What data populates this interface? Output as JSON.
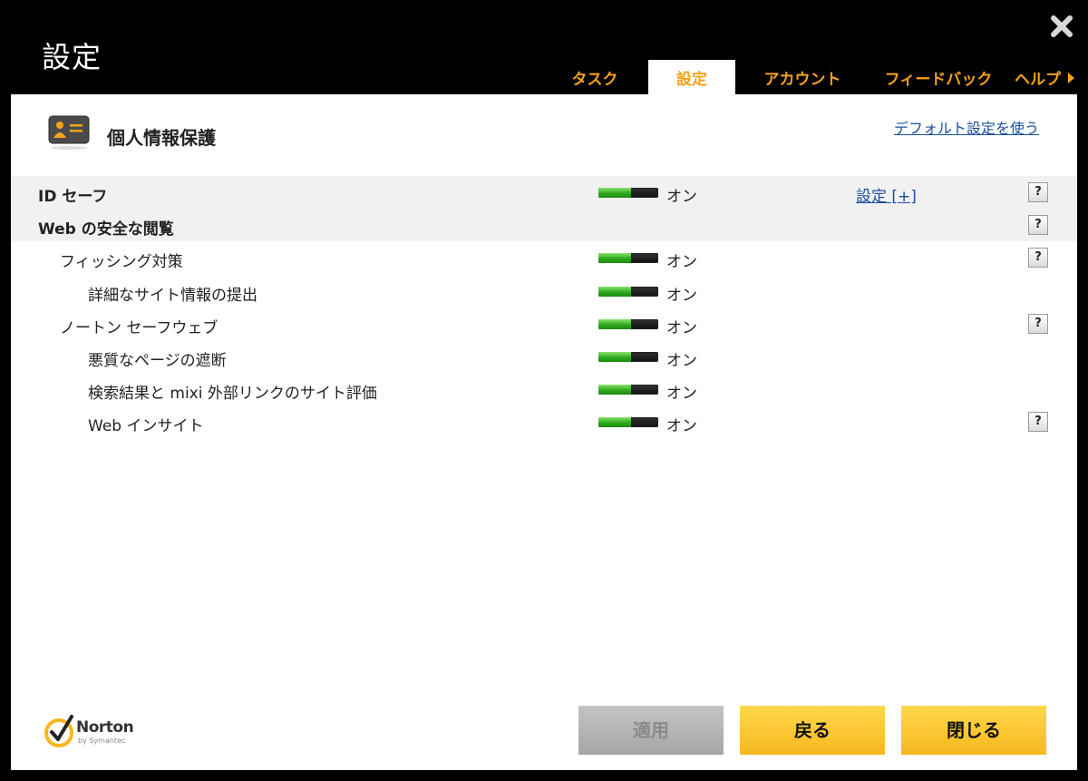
{
  "window": {
    "title": "設定"
  },
  "tabs": [
    {
      "label": "タスク",
      "active": false
    },
    {
      "label": "設定",
      "active": true
    },
    {
      "label": "アカウント",
      "active": false
    },
    {
      "label": "フィードバック",
      "active": false
    },
    {
      "label": "ヘルプ",
      "active": false
    }
  ],
  "header": {
    "icon": "id-card-icon",
    "title": "個人情報保護",
    "default_link": "デフォルト設定を使う"
  },
  "rows": [
    {
      "label": "ID セーフ",
      "state": "オン",
      "toggle_on": true,
      "settings_link": "設定 [+]",
      "help": "?"
    },
    {
      "label": "Web の安全な閲覧",
      "help": "?"
    },
    {
      "label": "フィッシング対策",
      "state": "オン",
      "toggle_on": true,
      "help": "?"
    },
    {
      "label": "詳細なサイト情報の提出",
      "state": "オン",
      "toggle_on": true
    },
    {
      "label": "ノートン セーフウェブ",
      "state": "オン",
      "toggle_on": true,
      "help": "?"
    },
    {
      "label": "悪質なページの遮断",
      "state": "オン",
      "toggle_on": true
    },
    {
      "label": "検索結果と mixi 外部リンクのサイト評価",
      "state": "オン",
      "toggle_on": true
    },
    {
      "label": "Web インサイト",
      "state": "オン",
      "toggle_on": true,
      "help": "?"
    }
  ],
  "footer": {
    "logo": {
      "brand": "Norton",
      "sub": "by Symantec"
    },
    "apply_label": "適用",
    "back_label": "戻る",
    "close_label": "閉じる"
  },
  "colors": {
    "tab_accent": "#f7a21a",
    "toggle_on": "#2eaa1c",
    "button_yellow": "#f6b81e",
    "link": "#1a4fa0"
  }
}
